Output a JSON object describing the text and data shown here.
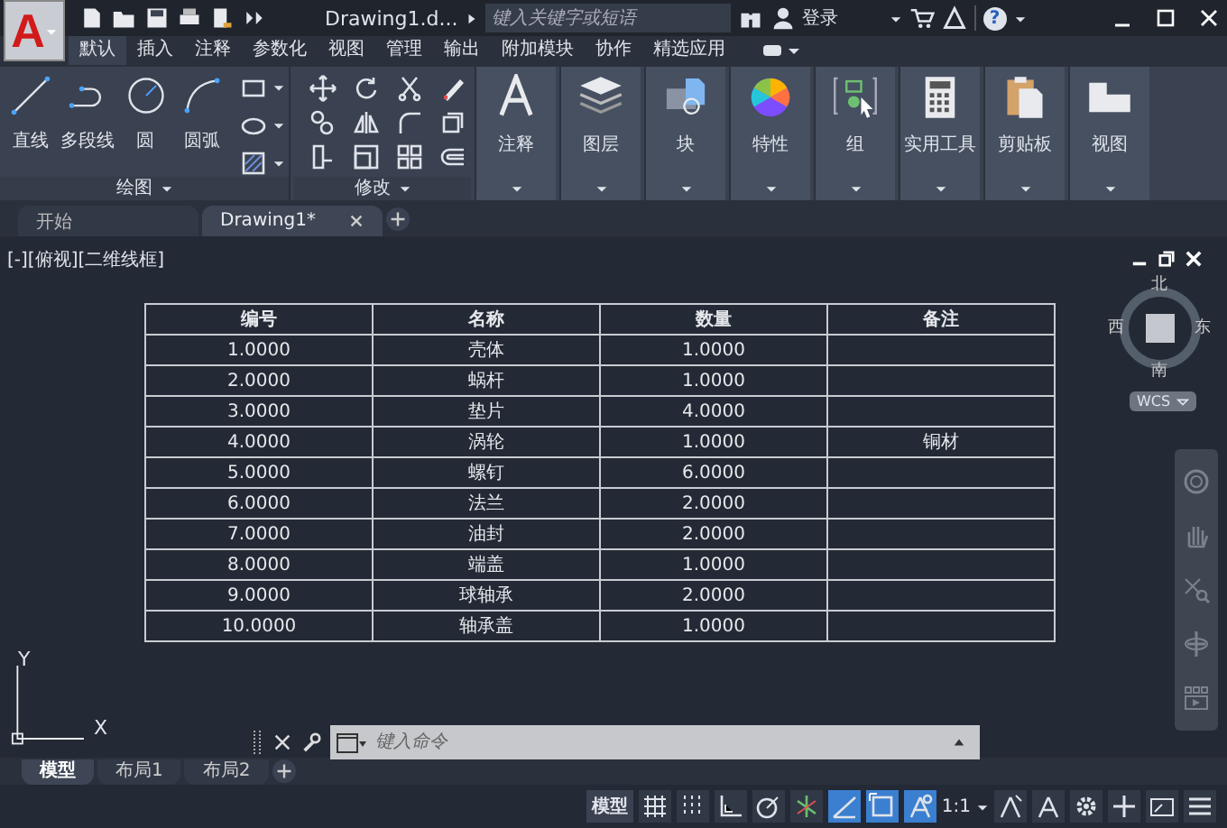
{
  "title_bar": {
    "logo_letter": "A",
    "document_title": "Drawing1.d...",
    "search_placeholder": "键入关键字或短语",
    "sign_in": "登录",
    "help_label": "?"
  },
  "ribbon_tabs": [
    {
      "label": "默认",
      "selected": true
    },
    {
      "label": "插入",
      "selected": false
    },
    {
      "label": "注释",
      "selected": false
    },
    {
      "label": "参数化",
      "selected": false
    },
    {
      "label": "视图",
      "selected": false
    },
    {
      "label": "管理",
      "selected": false
    },
    {
      "label": "输出",
      "selected": false
    },
    {
      "label": "附加模块",
      "selected": false
    },
    {
      "label": "协作",
      "selected": false
    },
    {
      "label": "精选应用",
      "selected": false
    }
  ],
  "ribbon": {
    "draw_panel": {
      "title": "绘图",
      "tools": [
        "直线",
        "多段线",
        "圆",
        "圆弧"
      ]
    },
    "modify_panel": {
      "title": "修改"
    },
    "big_buttons": [
      "注释",
      "图层",
      "块",
      "特性",
      "组",
      "实用工具",
      "剪贴板",
      "视图"
    ]
  },
  "file_tabs": [
    {
      "label": "开始",
      "selected": false,
      "closable": false
    },
    {
      "label": "Drawing1*",
      "selected": true,
      "closable": true
    }
  ],
  "viewport": {
    "label": "[-][俯视][二维线框]",
    "viewcube": {
      "north": "北",
      "south": "南",
      "west": "西",
      "east": "东",
      "coordinate_system": "WCS"
    },
    "ucs": {
      "y": "Y",
      "x": "X"
    }
  },
  "table": {
    "columns": [
      "编号",
      "名称",
      "数量",
      "备注"
    ],
    "rows": [
      [
        "1.0000",
        "壳体",
        "1.0000",
        ""
      ],
      [
        "2.0000",
        "蜗杆",
        "1.0000",
        ""
      ],
      [
        "3.0000",
        "垫片",
        "4.0000",
        ""
      ],
      [
        "4.0000",
        "涡轮",
        "1.0000",
        "铜材"
      ],
      [
        "5.0000",
        "螺钉",
        "6.0000",
        ""
      ],
      [
        "6.0000",
        "法兰",
        "2.0000",
        ""
      ],
      [
        "7.0000",
        "油封",
        "2.0000",
        ""
      ],
      [
        "8.0000",
        "端盖",
        "1.0000",
        ""
      ],
      [
        "9.0000",
        "球轴承",
        "2.0000",
        ""
      ],
      [
        "10.0000",
        "轴承盖",
        "1.0000",
        ""
      ]
    ]
  },
  "command_line": {
    "placeholder": "键入命令"
  },
  "layout_tabs": [
    {
      "label": "模型",
      "selected": true
    },
    {
      "label": "布局1",
      "selected": false
    },
    {
      "label": "布局2",
      "selected": false
    }
  ],
  "status_bar": {
    "model": "模型",
    "scale": "1:1",
    "toggles": [
      {
        "on": false
      },
      {
        "on": false
      },
      {
        "on": false
      },
      {
        "on": false
      },
      {
        "on": false
      },
      {
        "on": true
      },
      {
        "on": true
      },
      {
        "on": true
      },
      {
        "on": false
      },
      {
        "on": false
      }
    ]
  }
}
